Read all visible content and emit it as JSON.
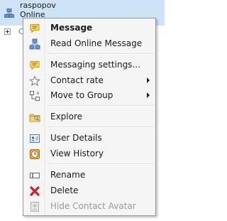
{
  "contact": {
    "name": "raspopov",
    "status": "Online",
    "group_label": "Cl"
  },
  "menu": {
    "items": [
      {
        "label": "Message",
        "icon": "speech-bubble-icon"
      },
      {
        "label": "Read Online Message",
        "icon": "network-users-icon"
      },
      {
        "label": "Messaging settings...",
        "icon": "speech-bubble-settings-icon"
      },
      {
        "label": "Contact rate",
        "icon": "star-icon"
      },
      {
        "label": "Move to Group",
        "icon": "move-group-icon"
      },
      {
        "label": "Explore",
        "icon": "folder-explore-icon"
      },
      {
        "label": "User Details",
        "icon": "user-card-icon"
      },
      {
        "label": "View History",
        "icon": "clock-icon"
      },
      {
        "label": "Rename",
        "icon": "rename-icon"
      },
      {
        "label": "Delete",
        "icon": "red-x-icon"
      },
      {
        "label": "Hide Contact Avatar",
        "icon": "avatar-icon"
      }
    ]
  }
}
